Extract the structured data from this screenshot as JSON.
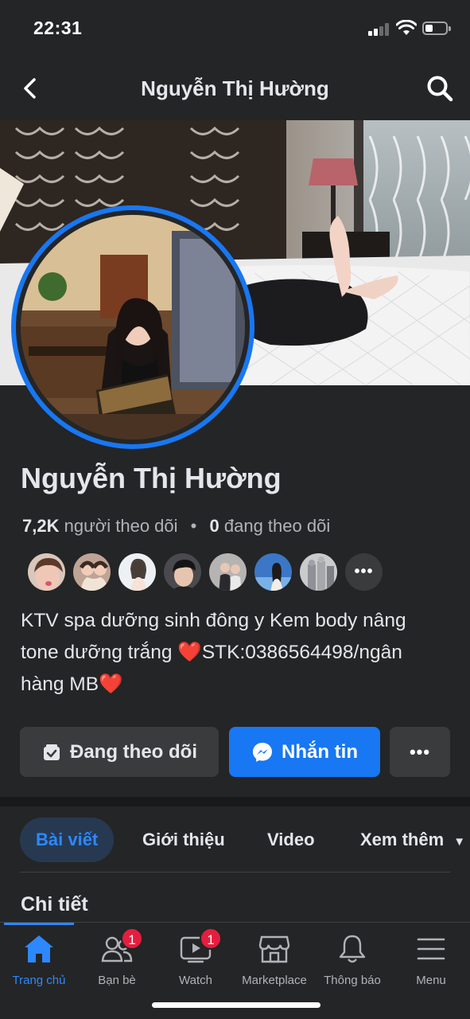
{
  "status": {
    "time": "22:31"
  },
  "header": {
    "title": "Nguyễn Thị Hường"
  },
  "profile": {
    "name": "Nguyễn Thị Hường",
    "followers_count": "7,2K",
    "followers_label": "người theo dõi",
    "following_count": "0",
    "following_label": "đang theo dõi",
    "bio_line1": "KTV spa dưỡng sinh đông y Kem body nâng",
    "bio_line2a": "tone dưỡng trắng ",
    "bio_line2b": "STK:0386564498/ngân",
    "bio_line3": "hàng MB"
  },
  "actions": {
    "following_label": "Đang theo dõi",
    "message_label": "Nhắn tin",
    "more_label": "•••"
  },
  "tabs": [
    "Bài viết",
    "Giới thiệu",
    "Video",
    "Xem thêm"
  ],
  "section": {
    "title": "Chi tiết"
  },
  "bottom_nav": [
    {
      "label": "Trang chủ",
      "icon": "home-icon",
      "badge": ""
    },
    {
      "label": "Bạn bè",
      "icon": "friends-icon",
      "badge": "1"
    },
    {
      "label": "Watch",
      "icon": "watch-icon",
      "badge": "1"
    },
    {
      "label": "Marketplace",
      "icon": "marketplace-icon",
      "badge": ""
    },
    {
      "label": "Thông báo",
      "icon": "bell-icon",
      "badge": ""
    },
    {
      "label": "Menu",
      "icon": "menu-icon",
      "badge": ""
    }
  ],
  "colors": {
    "accent": "#1877f2",
    "accent_text": "#2d88ff",
    "badge": "#e41e3f",
    "background": "#242526"
  },
  "follower_preview": {
    "more_label": "•••"
  }
}
